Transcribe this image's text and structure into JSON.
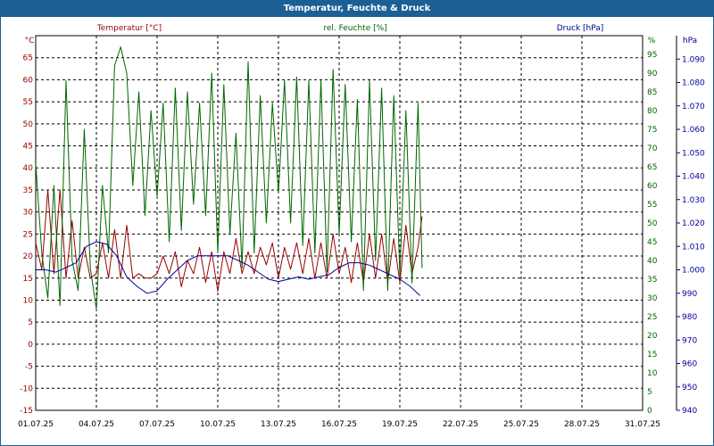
{
  "window": {
    "title": "Temperatur, Feuchte & Druck"
  },
  "colors": {
    "temperature": "#990000",
    "humidity": "#006600",
    "pressure": "#000099",
    "titlebar": "#1c5f95"
  },
  "chart_data": {
    "type": "line",
    "title": "Temperatur, Feuchte & Druck",
    "grid": true,
    "x_ticks": [
      "01.07.25",
      "04.07.25",
      "07.07.25",
      "10.07.25",
      "13.07.25",
      "16.07.25",
      "19.07.25",
      "22.07.25",
      "25.07.25",
      "28.07.25",
      "31.07.25"
    ],
    "xlim_days": [
      1,
      31
    ],
    "axes": {
      "temperature": {
        "unit": "°C",
        "label": "Temperatur [°C]",
        "ylim": [
          -15,
          70
        ],
        "ticks": [
          "65",
          "60",
          "55",
          "50",
          "45",
          "40",
          "35",
          "30",
          "25",
          "20",
          "15",
          "10",
          "5",
          "0",
          "-5",
          "-10",
          "-15"
        ]
      },
      "humidity": {
        "unit": "%",
        "label": "rel. Feuchte [%]",
        "ylim": [
          0,
          100
        ],
        "ticks": [
          "95",
          "90",
          "85",
          "80",
          "75",
          "70",
          "65",
          "60",
          "55",
          "50",
          "45",
          "40",
          "35",
          "30",
          "25",
          "20",
          "15",
          "10",
          "5",
          "0"
        ]
      },
      "pressure": {
        "unit": "hPa",
        "label": "Druck [hPa]",
        "ylim": [
          940,
          1100
        ],
        "ticks": [
          "1.090",
          "1.080",
          "1.070",
          "1.060",
          "1.050",
          "1.040",
          "1.030",
          "1.020",
          "1.010",
          "1.000",
          "990",
          "980",
          "970",
          "960",
          "950",
          "940"
        ]
      }
    },
    "series": [
      {
        "name": "Temperatur [°C]",
        "axis": "temperature",
        "color": "#990000",
        "x": [
          1.0,
          1.3,
          1.6,
          1.9,
          2.2,
          2.5,
          2.8,
          3.1,
          3.4,
          3.7,
          4.0,
          4.3,
          4.6,
          4.9,
          5.2,
          5.5,
          5.8,
          6.1,
          6.4,
          6.7,
          7.0,
          7.3,
          7.6,
          7.9,
          8.2,
          8.5,
          8.8,
          9.1,
          9.4,
          9.7,
          10.0,
          10.3,
          10.6,
          10.9,
          11.2,
          11.5,
          11.8,
          12.1,
          12.4,
          12.7,
          13.0,
          13.3,
          13.6,
          13.9,
          14.2,
          14.5,
          14.8,
          15.1,
          15.4,
          15.7,
          16.0,
          16.3,
          16.6,
          16.9,
          17.2,
          17.5,
          17.8,
          18.1,
          18.4,
          18.7,
          19.0,
          19.3,
          19.6,
          19.9,
          20.1
        ],
        "y": [
          23,
          17,
          35,
          16,
          35,
          15,
          28,
          15,
          22,
          15,
          16,
          23,
          15,
          26,
          15,
          27,
          15,
          16,
          15,
          15,
          16,
          20,
          16,
          21,
          13,
          19,
          16,
          22,
          14,
          21,
          12,
          21,
          16,
          24,
          16,
          21,
          16,
          22,
          18,
          23,
          15,
          22,
          17,
          23,
          16,
          24,
          15,
          23,
          15,
          25,
          16,
          22,
          14,
          23,
          14,
          25,
          15,
          25,
          14,
          24,
          14,
          27,
          16,
          22,
          29
        ]
      },
      {
        "name": "rel. Feuchte [%]",
        "axis": "humidity",
        "color": "#006600",
        "x": [
          1.0,
          1.3,
          1.6,
          1.9,
          2.2,
          2.5,
          2.8,
          3.1,
          3.4,
          3.7,
          4.0,
          4.3,
          4.6,
          4.9,
          5.2,
          5.5,
          5.8,
          6.1,
          6.4,
          6.7,
          7.0,
          7.3,
          7.6,
          7.9,
          8.2,
          8.5,
          8.8,
          9.1,
          9.4,
          9.7,
          10.0,
          10.3,
          10.6,
          10.9,
          11.2,
          11.5,
          11.8,
          12.1,
          12.4,
          12.7,
          13.0,
          13.3,
          13.6,
          13.9,
          14.2,
          14.5,
          14.8,
          15.1,
          15.4,
          15.7,
          16.0,
          16.3,
          16.6,
          16.9,
          17.2,
          17.5,
          17.8,
          18.1,
          18.4,
          18.7,
          19.0,
          19.3,
          19.6,
          19.9,
          20.1
        ],
        "y": [
          66,
          42,
          30,
          60,
          28,
          88,
          40,
          32,
          75,
          38,
          27,
          60,
          42,
          92,
          97,
          90,
          60,
          85,
          52,
          80,
          57,
          82,
          45,
          86,
          48,
          85,
          55,
          82,
          52,
          90,
          42,
          87,
          47,
          74,
          38,
          93,
          42,
          84,
          50,
          82,
          58,
          88,
          50,
          89,
          44,
          88,
          42,
          88,
          37,
          91,
          47,
          87,
          45,
          83,
          32,
          88,
          40,
          86,
          32,
          84,
          36,
          80,
          34,
          82,
          38
        ]
      },
      {
        "name": "Druck [hPa]",
        "axis": "pressure",
        "color": "#000099",
        "x": [
          1.0,
          1.5,
          2.0,
          2.5,
          3.0,
          3.5,
          4.0,
          4.5,
          5.0,
          5.5,
          6.0,
          6.5,
          7.0,
          7.5,
          8.0,
          8.5,
          9.0,
          9.5,
          10.0,
          10.5,
          11.0,
          11.5,
          12.0,
          12.5,
          13.0,
          13.5,
          14.0,
          14.5,
          15.0,
          15.5,
          16.0,
          16.5,
          17.0,
          17.5,
          18.0,
          18.5,
          19.0,
          19.5,
          20.0
        ],
        "y": [
          1000,
          1000,
          999,
          1001,
          1003,
          1010,
          1012,
          1011,
          1006,
          997,
          993,
          990,
          991,
          996,
          1000,
          1004,
          1006,
          1006,
          1006,
          1006,
          1004,
          1002,
          999,
          996,
          995,
          996,
          997,
          996,
          997,
          998,
          1001,
          1003,
          1003,
          1002,
          1000,
          998,
          996,
          993,
          989
        ]
      }
    ]
  }
}
